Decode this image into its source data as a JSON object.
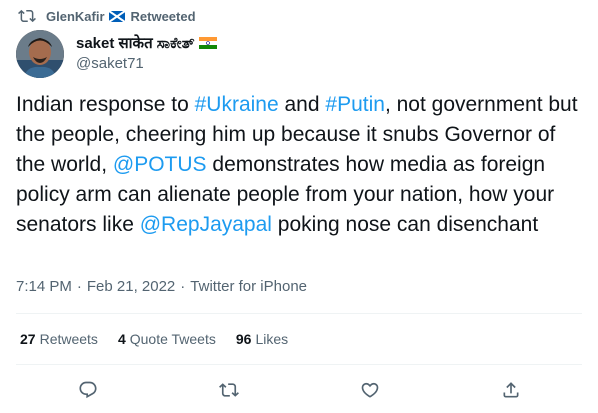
{
  "retweet_header": {
    "retweeter": "GlenKafir",
    "label": "Retweeted",
    "icon": "retweet-icon",
    "flag": "scotland-flag"
  },
  "author": {
    "display_name": "saket साकेत ಸಾಕೇತ್",
    "handle": "@saket71",
    "flag": "india-flag"
  },
  "tweet": {
    "text_1": "Indian response to ",
    "hashtag_1": "#Ukraine",
    "text_2": " and ",
    "hashtag_2": "#Putin",
    "text_3": ", not government but the people, cheering him up because it snubs Governor of the world, ",
    "mention_1": "@POTUS",
    "text_4": " demonstrates how media as foreign policy arm can alienate people from your nation, how your senators like ",
    "mention_2": "@RepJayapal",
    "text_5": " poking nose can disenchant"
  },
  "meta": {
    "time": "7:14 PM",
    "separator": "·",
    "date": "Feb 21, 2022",
    "source": "Twitter for iPhone"
  },
  "stats": {
    "retweets_count": "27",
    "retweets_label": "Retweets",
    "quotes_count": "4",
    "quotes_label": "Quote Tweets",
    "likes_count": "96",
    "likes_label": "Likes"
  },
  "actions": [
    "reply-icon",
    "retweet-icon",
    "like-icon",
    "share-icon"
  ],
  "colors": {
    "link": "#1d9bf0",
    "secondary_text": "#536471",
    "primary_text": "#0f1419",
    "divider": "#eff3f4"
  }
}
